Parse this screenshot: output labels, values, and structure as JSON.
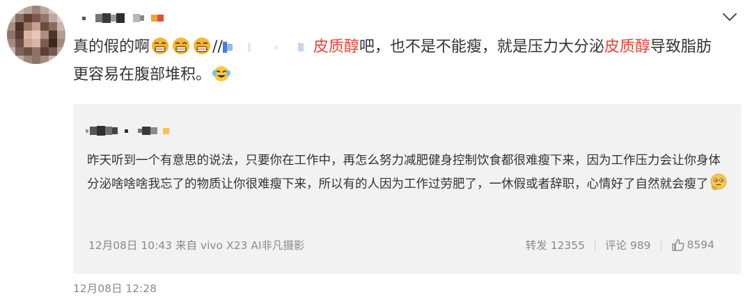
{
  "post": {
    "text_before": "真的假的啊",
    "repost_marker": "//",
    "keyword": "皮质醇",
    "text_mid": "吧，也不是不能瘦，就是压力大分泌",
    "keyword2": "皮质醇",
    "text_after": "导致脂肪更容易在腹部堆积。",
    "timestamp": "12月08日 12:28"
  },
  "quoted": {
    "text": "昨天听到一个有意思的说法，只要你在工作中，再怎么努力减肥健身控制饮食都很难瘦下来，因为工作压力会让你身体分泌啥啥啥我忘了的物质让你很难瘦下来，所以有的人因为工作过劳肥了，一休假或者辞职，心情好了自然就会瘦了",
    "source": "12月08日 10:43 来自 vivo X23 AI非凡摄影",
    "repost_label": "转发 12355",
    "comment_label": "评论 989",
    "likes": "8594"
  },
  "colors": {
    "keyword": "#eb3f38",
    "meta": "#8a8a8a",
    "quote_bg": "#f2f2f2"
  },
  "icons": [
    "chevron-down-icon",
    "laughing-tears-emoji",
    "grimacing-emoji",
    "thinking-face-emoji",
    "thumbs-up-icon"
  ]
}
